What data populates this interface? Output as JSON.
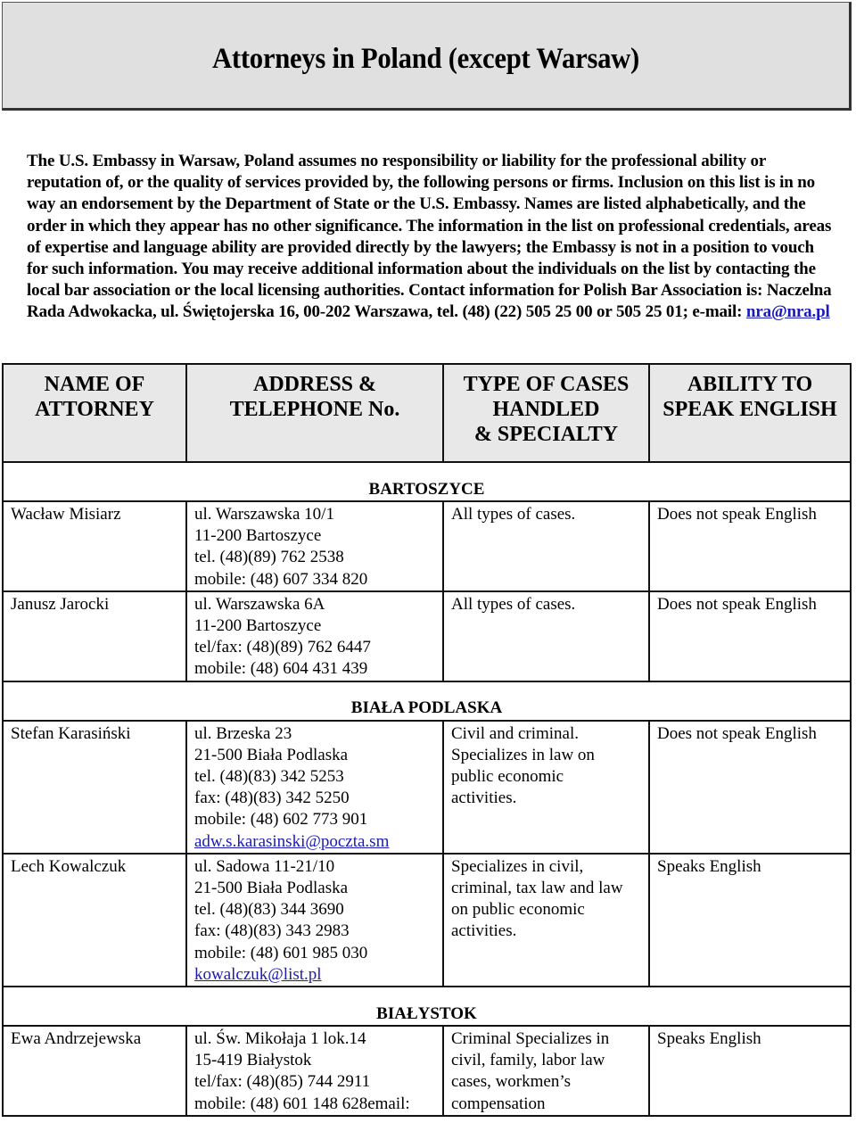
{
  "document": {
    "title": "Attorneys in Poland (except Warsaw)",
    "disclaimer": {
      "text": "The U.S. Embassy in Warsaw, Poland assumes no responsibility or liability for the professional ability or reputation of, or the quality of services provided by, the following persons or firms. Inclusion on this list is in no way an endorsement by the Department of State or the U.S. Embassy. Names are listed alphabetically, and the order in which they appear has no other significance. The information in the list on professional credentials, areas of expertise and language ability are provided directly by the lawyers; the Embassy is not in a position to vouch for such information. You may receive additional information about the individuals on the list by contacting the local bar association or the local licensing authorities. Contact information for Polish Bar Association is: Naczelna Rada Adwokacka, ul. Świętojerska 16, 00-202 Warszawa, tel. (48) (22) 505 25 00 or 505 25 01; e-mail: ",
      "email_link": "nra@nra.pl"
    },
    "link_color": "#1a1ab8"
  },
  "table": {
    "headers": {
      "name": "NAME OF ATTORNEY",
      "address": "ADDRESS & TELEPHONE No.",
      "cases": "TYPE OF CASES HANDLED & SPECIALTY",
      "english": "ABILITY TO SPEAK ENGLISH"
    },
    "headers_lines": {
      "name": [
        "NAME OF",
        "ATTORNEY"
      ],
      "address": [
        "ADDRESS &",
        "TELEPHONE No."
      ],
      "cases": [
        "TYPE OF CASES",
        "HANDLED",
        "& SPECIALTY"
      ],
      "english": [
        "ABILITY TO",
        "SPEAK ENGLISH"
      ]
    },
    "sections": [
      {
        "city": "BARTOSZYCE",
        "attorneys": [
          {
            "name": "Wacław Misiarz",
            "address": [
              "ul. Warszawska 10/1",
              "11-200 Bartoszyce",
              "tel. (48)(89) 762 2538",
              "mobile: (48) 607 334 820"
            ],
            "email": null,
            "cases": [
              "All types of cases."
            ],
            "english": "Does not speak English"
          },
          {
            "name": "Janusz Jarocki",
            "address": [
              "ul. Warszawska 6A",
              "11-200 Bartoszyce",
              "tel/fax: (48)(89) 762 6447",
              "mobile: (48) 604 431 439"
            ],
            "email": null,
            "cases": [
              "All types of cases."
            ],
            "english": "Does not speak English"
          }
        ]
      },
      {
        "city": "BIAŁA PODLASKA",
        "attorneys": [
          {
            "name": "Stefan Karasiński",
            "address": [
              "ul. Brzeska 23",
              "21-500 Biała Podlaska",
              "tel. (48)(83) 342 5253",
              "fax: (48)(83) 342 5250",
              "mobile: (48) 602 773 901"
            ],
            "email": "adw.s.karasinski@poczta.sm",
            "cases": [
              "Civil and criminal.",
              "Specializes in law on",
              "public economic",
              "activities."
            ],
            "english": "Does not speak English"
          },
          {
            "name": "Lech Kowalczuk",
            "address": [
              "ul. Sadowa 11-21/10",
              "21-500 Biała Podlaska",
              "tel. (48)(83) 344 3690",
              "fax: (48)(83) 343 2983",
              "mobile: (48) 601 985 030"
            ],
            "email": "kowalczuk@list.pl",
            "cases": [
              "Specializes in civil,",
              "criminal, tax law and law",
              "on public economic",
              "activities."
            ],
            "english": "Speaks English"
          }
        ]
      },
      {
        "city": "BIAŁYSTOK",
        "attorneys": [
          {
            "name": "Ewa Andrzejewska",
            "address": [
              "ul. Św. Mikołaja 1 lok.14",
              "15-419 Białystok",
              "tel/fax: (48)(85) 744 2911",
              "mobile: (48) 601 148 628email:"
            ],
            "email": null,
            "cases": [
              "Criminal Specializes in",
              "civil, family, labor law",
              "cases, workmen’s",
              "compensation"
            ],
            "english": "Speaks English"
          }
        ]
      }
    ]
  }
}
